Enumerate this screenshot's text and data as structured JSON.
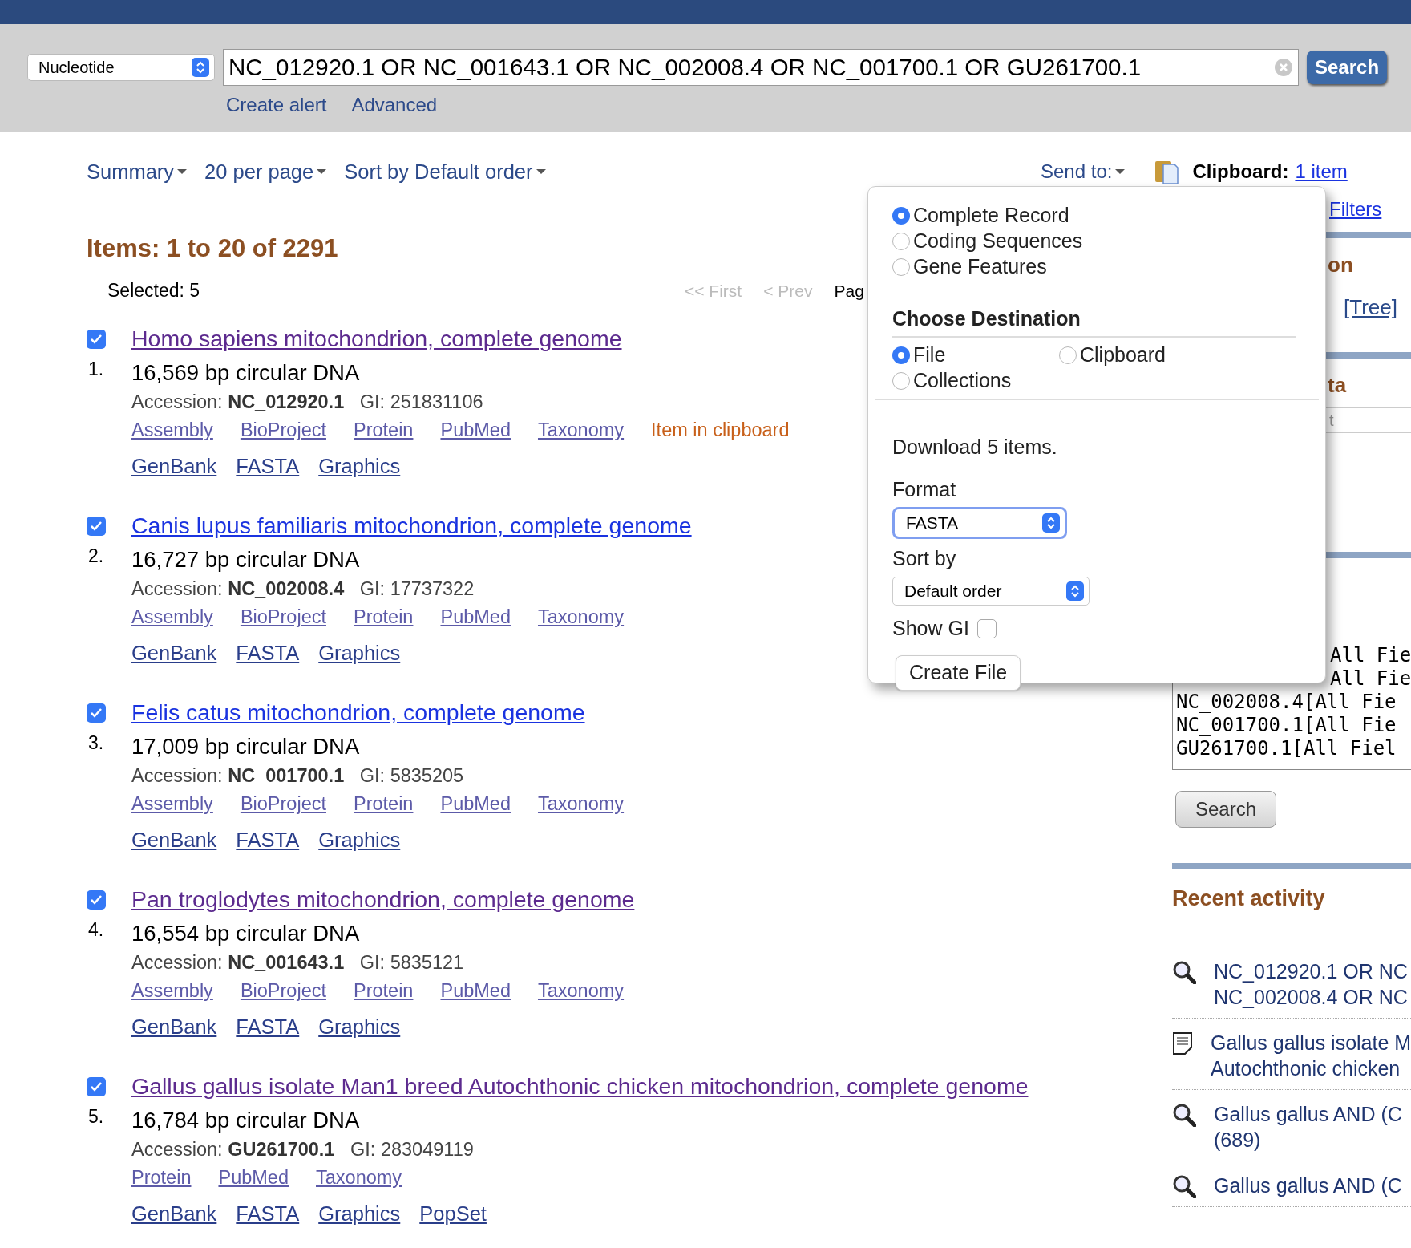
{
  "search_bar": {
    "database": "Nucleotide",
    "query": "NC_012920.1 OR NC_001643.1 OR NC_002008.4 OR NC_001700.1 OR GU261700.1",
    "button": "Search",
    "links": [
      "Create alert",
      "Advanced"
    ]
  },
  "toolbar": {
    "menus": [
      "Summary",
      "20 per page",
      "Sort by Default order"
    ],
    "send_to": "Send to:",
    "clipboard_label": "Clipboard:",
    "clipboard_link": "1 item"
  },
  "results_header": {
    "title": "Items: 1 to 20 of 2291",
    "selected": "Selected: 5",
    "pager": [
      "<< First",
      "< Prev",
      "Pag"
    ]
  },
  "results": [
    {
      "number": "1.",
      "title": "Homo sapiens mitochondrion, complete genome",
      "visited": true,
      "checked": true,
      "description": "16,569 bp circular DNA",
      "accession_label": "Accession:",
      "accession": "NC_012920.1",
      "gi": "GI: 251831106",
      "links": [
        "Assembly",
        "BioProject",
        "Protein",
        "PubMed",
        "Taxonomy"
      ],
      "status": "Item in clipboard",
      "format_links": [
        "GenBank",
        "FASTA",
        "Graphics"
      ]
    },
    {
      "number": "2.",
      "title": "Canis lupus familiaris mitochondrion, complete genome",
      "visited": false,
      "checked": true,
      "description": "16,727 bp circular DNA",
      "accession_label": "Accession:",
      "accession": "NC_002008.4",
      "gi": "GI: 17737322",
      "links": [
        "Assembly",
        "BioProject",
        "Protein",
        "PubMed",
        "Taxonomy"
      ],
      "format_links": [
        "GenBank",
        "FASTA",
        "Graphics"
      ]
    },
    {
      "number": "3.",
      "title": "Felis catus mitochondrion, complete genome",
      "visited": false,
      "checked": true,
      "description": "17,009 bp circular DNA",
      "accession_label": "Accession:",
      "accession": "NC_001700.1",
      "gi": "GI: 5835205",
      "links": [
        "Assembly",
        "BioProject",
        "Protein",
        "PubMed",
        "Taxonomy"
      ],
      "format_links": [
        "GenBank",
        "FASTA",
        "Graphics"
      ]
    },
    {
      "number": "4.",
      "title": "Pan troglodytes mitochondrion, complete genome",
      "visited": true,
      "checked": true,
      "description": "16,554 bp circular DNA",
      "accession_label": "Accession:",
      "accession": "NC_001643.1",
      "gi": "GI: 5835121",
      "links": [
        "Assembly",
        "BioProject",
        "Protein",
        "PubMed",
        "Taxonomy"
      ],
      "format_links": [
        "GenBank",
        "FASTA",
        "Graphics"
      ]
    },
    {
      "number": "5.",
      "title": "Gallus gallus isolate Man1 breed Autochthonic chicken mitochondrion, complete genome",
      "visited": true,
      "checked": true,
      "description": "16,784 bp circular DNA",
      "accession_label": "Accession:",
      "accession": "GU261700.1",
      "gi": "GI: 283049119",
      "links": [
        "Protein",
        "PubMed",
        "Taxonomy"
      ],
      "format_links": [
        "GenBank",
        "FASTA",
        "Graphics",
        "PopSet"
      ]
    }
  ],
  "send_to_popup": {
    "record_options": [
      {
        "label": "Complete Record",
        "selected": true
      },
      {
        "label": "Coding Sequences",
        "selected": false
      },
      {
        "label": "Gene Features",
        "selected": false
      }
    ],
    "destination_title": "Choose Destination",
    "destinations": [
      {
        "label": "File",
        "selected": true
      },
      {
        "label": "Clipboard",
        "selected": false
      },
      {
        "label": "Collections",
        "selected": false
      }
    ],
    "download_text": "Download 5 items.",
    "format_label": "Format",
    "format_value": "FASTA",
    "sort_label": "Sort by",
    "sort_value": "Default order",
    "show_gi_label": "Show GI",
    "show_gi_checked": false,
    "button": "Create File"
  },
  "sidebar": {
    "filters_link": "Filters",
    "heading_1": "on",
    "tree_link": "[Tree]",
    "heading_2": "ta",
    "field_fragment": "t",
    "query_lines": [
      "All Fie",
      "All Fie",
      "NC_002008.4[All Fie",
      "NC_001700.1[All Fie",
      "GU261700.1[All Fiel"
    ],
    "search_button": "Search",
    "recent_title": "Recent activity",
    "recent": [
      {
        "kind": "search",
        "lines": [
          "NC_012920.1 OR NC",
          "NC_002008.4 OR NC"
        ]
      },
      {
        "kind": "record",
        "lines": [
          "Gallus gallus isolate M",
          "Autochthonic chicken"
        ]
      },
      {
        "kind": "search",
        "lines": [
          "Gallus gallus AND (C",
          "(689)"
        ]
      },
      {
        "kind": "search",
        "lines": [
          "Gallus gallus AND (C"
        ]
      }
    ]
  }
}
